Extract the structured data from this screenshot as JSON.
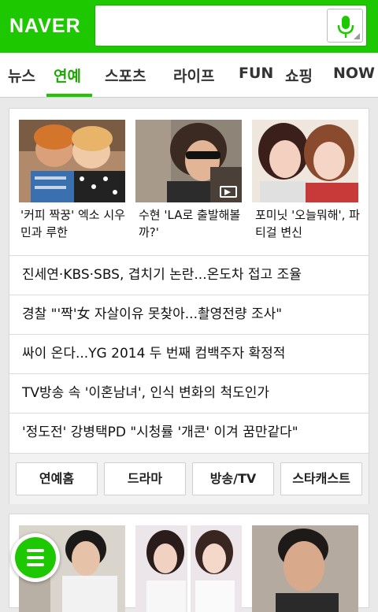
{
  "header": {
    "logo": "NAVER",
    "search_placeholder": "",
    "brand_color": "#1ec800"
  },
  "tabs": [
    {
      "label": "뉴스",
      "active": false
    },
    {
      "label": "연예",
      "active": true
    },
    {
      "label": "스포츠",
      "active": false
    },
    {
      "label": "라이프",
      "active": false
    },
    {
      "label": "FUN",
      "active": false
    },
    {
      "label": "쇼핑",
      "active": false
    },
    {
      "label": "NOW",
      "active": false
    }
  ],
  "photo_news": [
    {
      "caption": "'커피 짝꿍' 엑소 시우민과 루한",
      "video": false
    },
    {
      "caption": "수현 'LA로 출발해볼까?'",
      "video": true
    },
    {
      "caption": "포미닛 '오늘뭐해', 파티걸 변신",
      "video": false
    }
  ],
  "headlines": [
    "진세연·KBS·SBS, 겹치기 논란...온도차 접고 조율",
    "경찰 \"'짝'女 자살이유 못찾아...촬영전량 조사\"",
    "싸이 온다...YG 2014 두 번째 컴백주자 확정적",
    "TV방송 속 '이혼남녀', 인식 변화의 척도인가",
    "'정도전' 강병택PD \"시청률 '개콘' 이겨 꿈만같다\""
  ],
  "section_buttons": [
    "연예홈",
    "드라마",
    "방송/TV",
    "스타캐스트"
  ],
  "icons": {
    "mic": "microphone-icon",
    "menu": "hamburger-menu-icon",
    "video": "video-play-icon"
  }
}
